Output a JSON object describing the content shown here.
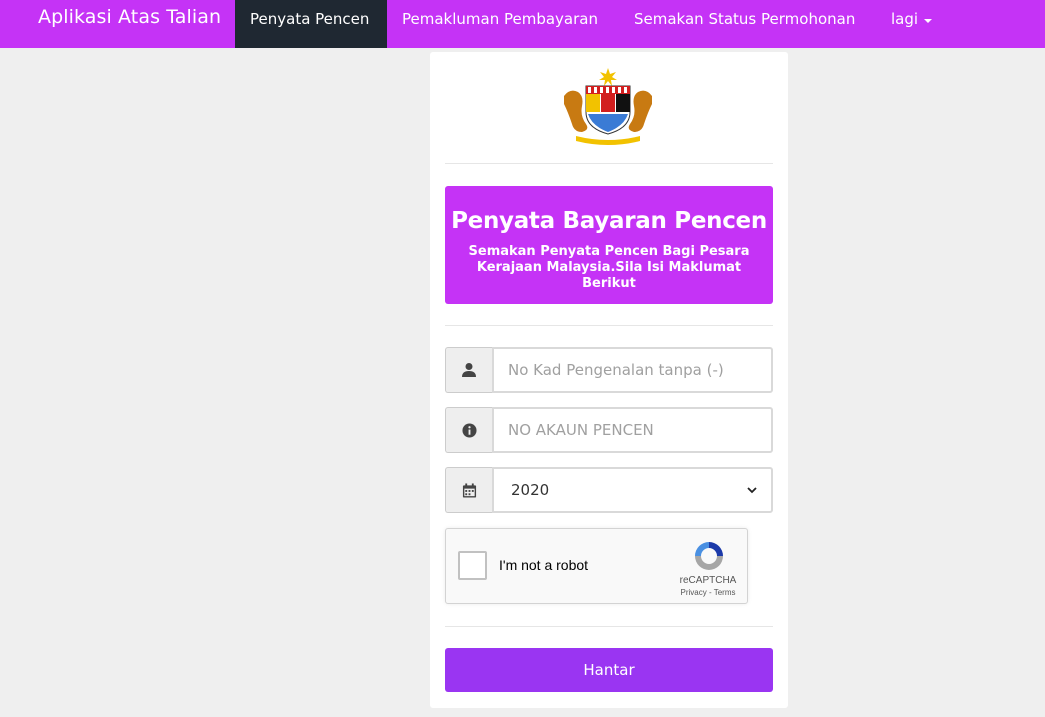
{
  "navbar": {
    "brand": "Aplikasi Atas Talian",
    "items": [
      {
        "label": "Penyata Pencen",
        "active": true
      },
      {
        "label": "Pemakluman Pembayaran",
        "active": false
      },
      {
        "label": "Semakan Status Permohonan",
        "active": false
      },
      {
        "label": "lagi",
        "active": false
      }
    ],
    "color": "#c533f6",
    "active_color": "#1f2832"
  },
  "banner": {
    "title": "Penyata Bayaran Pencen",
    "subtitle": "Semakan Penyata Pencen Bagi Pesara Kerajaan Malaysia.Sila Isi Maklumat Berikut"
  },
  "form": {
    "ic_placeholder": "No Kad Pengenalan tanpa (-)",
    "account_placeholder": "NO AKAUN PENCEN",
    "year_selected": "2020",
    "icons": {
      "ic": "user-icon",
      "account": "info-icon",
      "year": "calendar-icon"
    }
  },
  "recaptcha": {
    "label": "I'm not a robot",
    "brand": "reCAPTCHA",
    "links": "Privacy - Terms"
  },
  "submit_label": "Hantar"
}
